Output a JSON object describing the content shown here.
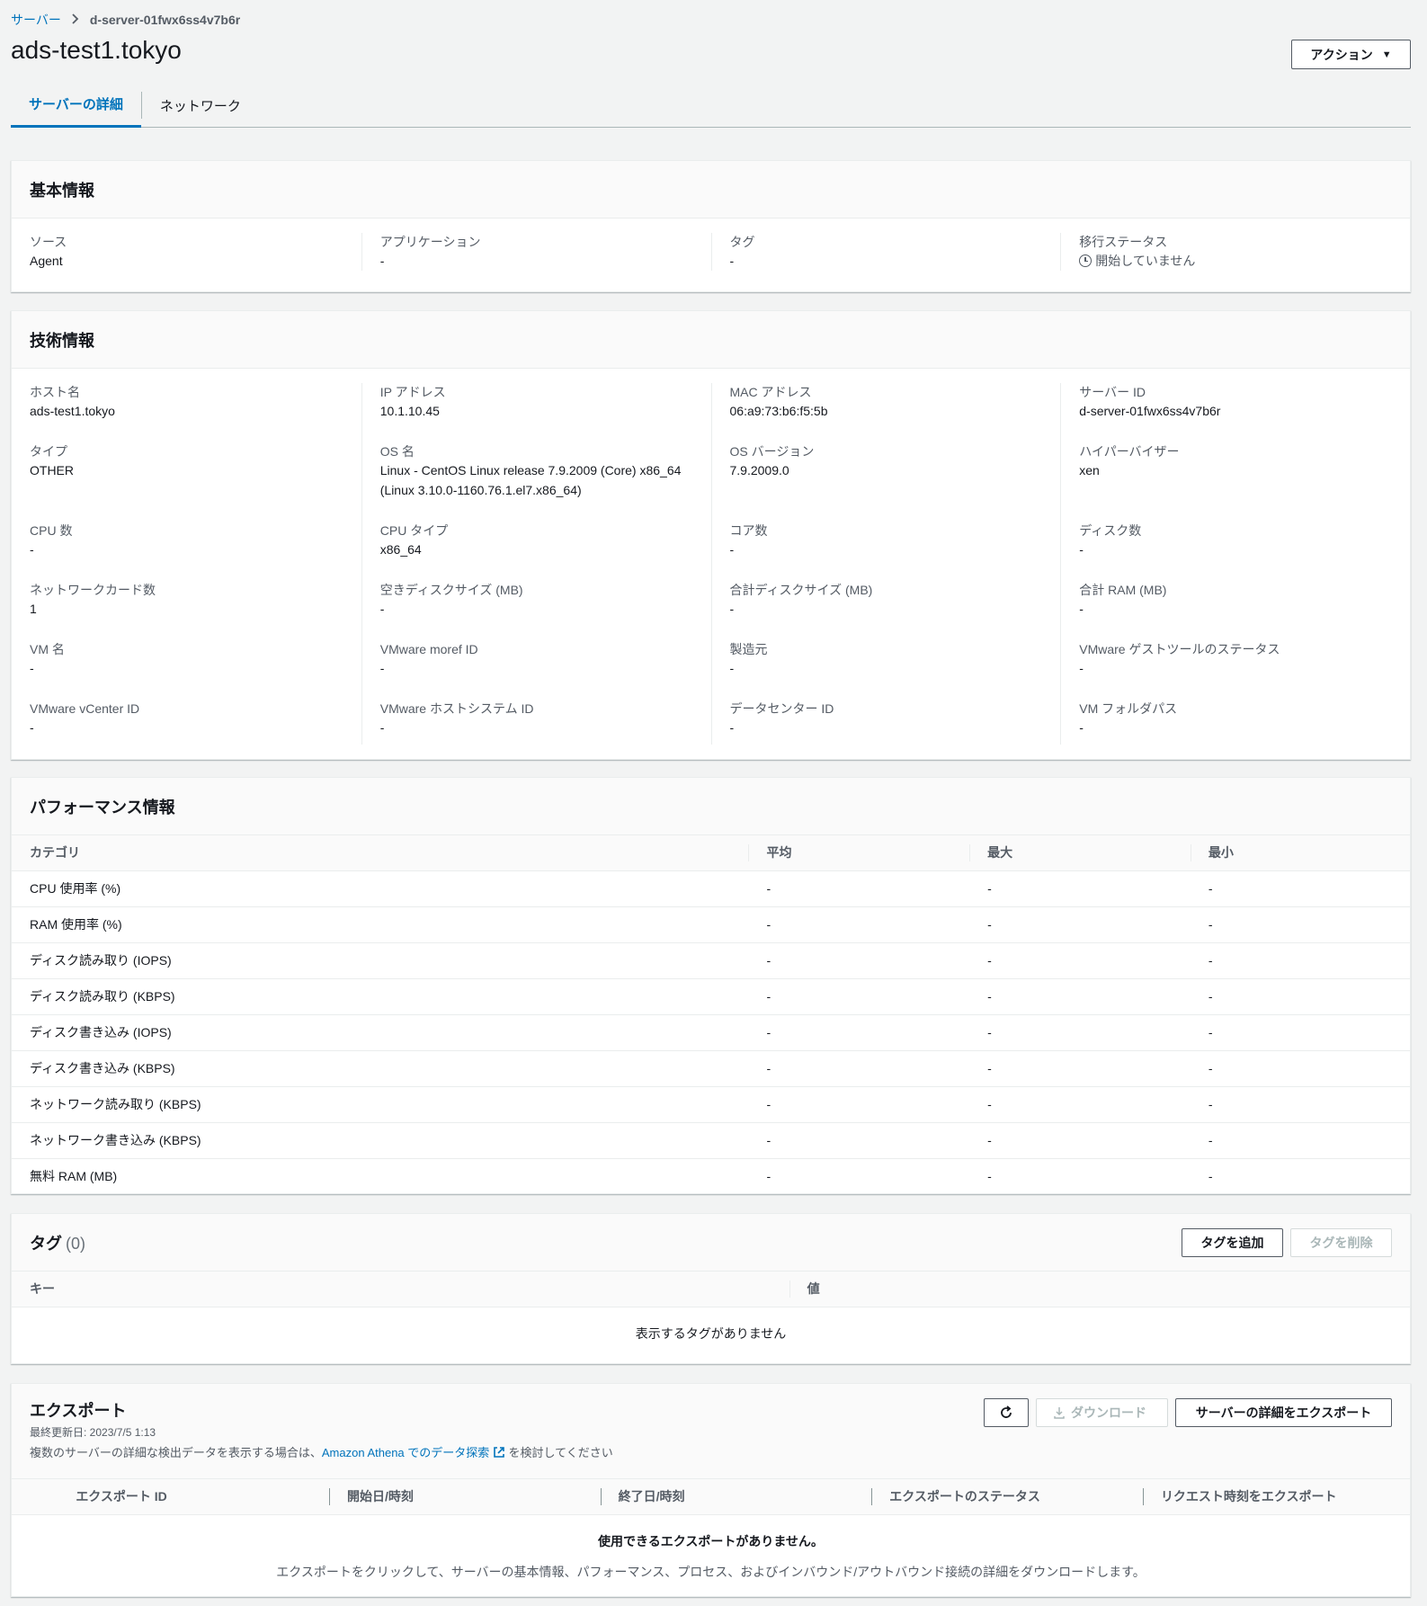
{
  "breadcrumb": {
    "parent": "サーバー",
    "current": "d-server-01fwx6ss4v7b6r"
  },
  "title": "ads-test1.tokyo",
  "action_button": "アクション",
  "tabs": [
    "サーバーの詳細",
    "ネットワーク"
  ],
  "basic_info": {
    "title": "基本情報",
    "fields": [
      {
        "label": "ソース",
        "value": "Agent"
      },
      {
        "label": "アプリケーション",
        "value": "-"
      },
      {
        "label": "タグ",
        "value": "-"
      },
      {
        "label": "移行ステータス",
        "value": "開始していません"
      }
    ]
  },
  "tech_info": {
    "title": "技術情報",
    "fields": [
      {
        "label": "ホスト名",
        "value": "ads-test1.tokyo"
      },
      {
        "label": "IP アドレス",
        "value": "10.1.10.45"
      },
      {
        "label": "MAC アドレス",
        "value": "06:a9:73:b6:f5:5b"
      },
      {
        "label": "サーバー ID",
        "value": "d-server-01fwx6ss4v7b6r"
      },
      {
        "label": "タイプ",
        "value": "OTHER"
      },
      {
        "label": "OS 名",
        "value": "Linux - CentOS Linux release 7.9.2009 (Core) x86_64 (Linux 3.10.0-1160.76.1.el7.x86_64)"
      },
      {
        "label": "OS バージョン",
        "value": "7.9.2009.0"
      },
      {
        "label": "ハイパーバイザー",
        "value": "xen"
      },
      {
        "label": "CPU 数",
        "value": "-"
      },
      {
        "label": "CPU タイプ",
        "value": "x86_64"
      },
      {
        "label": "コア数",
        "value": "-"
      },
      {
        "label": "ディスク数",
        "value": "-"
      },
      {
        "label": "ネットワークカード数",
        "value": "1"
      },
      {
        "label": "空きディスクサイズ (MB)",
        "value": "-"
      },
      {
        "label": "合計ディスクサイズ (MB)",
        "value": "-"
      },
      {
        "label": "合計 RAM (MB)",
        "value": "-"
      },
      {
        "label": "VM 名",
        "value": "-"
      },
      {
        "label": "VMware moref ID",
        "value": "-"
      },
      {
        "label": "製造元",
        "value": "-"
      },
      {
        "label": "VMware ゲストツールのステータス",
        "value": "-"
      },
      {
        "label": "VMware vCenter ID",
        "value": "-"
      },
      {
        "label": "VMware ホストシステム ID",
        "value": "-"
      },
      {
        "label": "データセンター ID",
        "value": "-"
      },
      {
        "label": "VM フォルダパス",
        "value": "-"
      }
    ]
  },
  "performance": {
    "title": "パフォーマンス情報",
    "columns": [
      "カテゴリ",
      "平均",
      "最大",
      "最小"
    ],
    "rows": [
      [
        "CPU 使用率 (%)",
        "-",
        "-",
        "-"
      ],
      [
        "RAM 使用率 (%)",
        "-",
        "-",
        "-"
      ],
      [
        "ディスク読み取り (IOPS)",
        "-",
        "-",
        "-"
      ],
      [
        "ディスク読み取り (KBPS)",
        "-",
        "-",
        "-"
      ],
      [
        "ディスク書き込み (IOPS)",
        "-",
        "-",
        "-"
      ],
      [
        "ディスク書き込み (KBPS)",
        "-",
        "-",
        "-"
      ],
      [
        "ネットワーク読み取り (KBPS)",
        "-",
        "-",
        "-"
      ],
      [
        "ネットワーク書き込み (KBPS)",
        "-",
        "-",
        "-"
      ],
      [
        "無料 RAM (MB)",
        "-",
        "-",
        "-"
      ]
    ]
  },
  "tags": {
    "title": "タグ",
    "count": "(0)",
    "add_button": "タグを追加",
    "remove_button": "タグを削除",
    "columns": [
      "キー",
      "値"
    ],
    "empty": "表示するタグがありません"
  },
  "export": {
    "title": "エクスポート",
    "last_updated": "最終更新日: 2023/7/5 1:13",
    "note_prefix": "複数のサーバーの詳細な検出データを表示する場合は、",
    "note_link": "Amazon Athena でのデータ探索",
    "note_suffix": "を検討してください",
    "download_button": "ダウンロード",
    "export_button": "サーバーの詳細をエクスポート",
    "columns": [
      "エクスポート ID",
      "開始日/時刻",
      "終了日/時刻",
      "エクスポートのステータス",
      "リクエスト時刻をエクスポート"
    ],
    "empty_title": "使用できるエクスポートがありません。",
    "empty_desc": "エクスポートをクリックして、サーバーの基本情報、パフォーマンス、プロセス、およびインバウンド/アウトバウンド接続の詳細をダウンロードします。"
  },
  "colors": {
    "link": "#0073bb",
    "text": "#16191f",
    "muted": "#545b64",
    "background": "#f2f3f3"
  }
}
